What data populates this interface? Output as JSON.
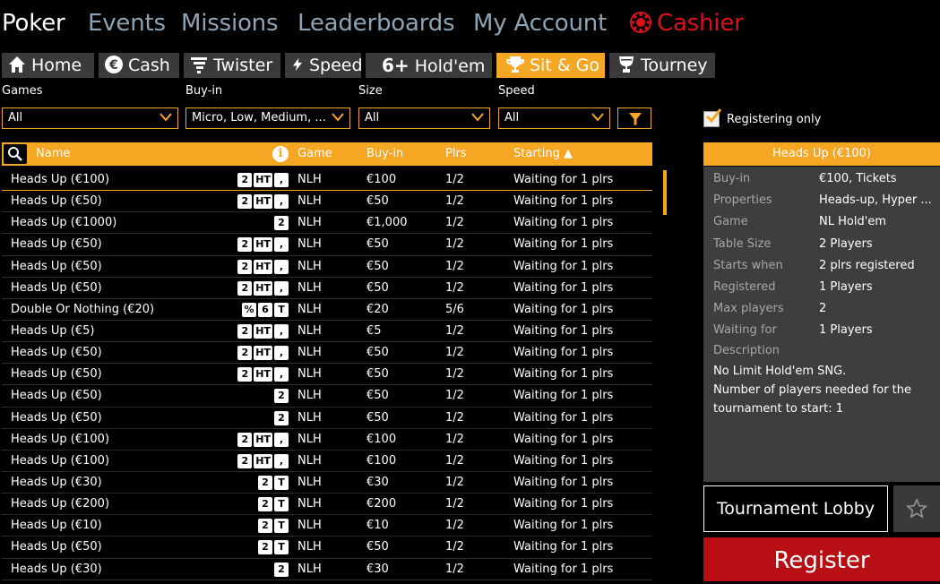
{
  "nav": {
    "items": [
      {
        "label": "Poker",
        "active": true
      },
      {
        "label": "Events"
      },
      {
        "label": "Missions"
      },
      {
        "label": "Leaderboards"
      },
      {
        "label": "My Account"
      },
      {
        "label": "Cashier",
        "icon": "cashier-chip-icon"
      }
    ]
  },
  "tabs": [
    {
      "label": "Home",
      "icon": "home-icon"
    },
    {
      "label": "Cash",
      "icon": "euro-coin-icon"
    },
    {
      "label": "Twister",
      "icon": "twister-icon"
    },
    {
      "label": "Speed",
      "icon": "lightning-icon"
    },
    {
      "label": "Hold'em",
      "icon_text": "6+"
    },
    {
      "label": "Sit & Go",
      "icon": "trophy-icon",
      "active": true
    },
    {
      "label": "Tourney",
      "icon": "trophy-cup-icon"
    }
  ],
  "filters": {
    "games": {
      "label": "Games",
      "value": "All"
    },
    "buyin": {
      "label": "Buy-in",
      "value": "Micro, Low, Medium, ..."
    },
    "size": {
      "label": "Size",
      "value": "All"
    },
    "speed": {
      "label": "Speed",
      "value": "All"
    },
    "registering_only": {
      "label": "Registering only",
      "checked": true
    }
  },
  "table": {
    "columns": {
      "name": "Name",
      "game": "Game",
      "buyin": "Buy-in",
      "plrs": "Plrs",
      "starting": "Starting ▲"
    },
    "rows": [
      {
        "name": "Heads Up (€100)",
        "badges": [
          "2",
          "HT",
          ","
        ],
        "game": "NLH",
        "buyin": "€100",
        "plrs": "1/2",
        "starting": "Waiting for 1 plrs"
      },
      {
        "name": "Heads Up (€50)",
        "badges": [
          "2",
          "HT",
          ","
        ],
        "game": "NLH",
        "buyin": "€50",
        "plrs": "1/2",
        "starting": "Waiting for 1 plrs"
      },
      {
        "name": "Heads Up (€1000)",
        "badges": [
          "2"
        ],
        "game": "NLH",
        "buyin": "€1,000",
        "plrs": "1/2",
        "starting": "Waiting for 1 plrs"
      },
      {
        "name": "Heads Up (€50)",
        "badges": [
          "2",
          "HT",
          ","
        ],
        "game": "NLH",
        "buyin": "€50",
        "plrs": "1/2",
        "starting": "Waiting for 1 plrs"
      },
      {
        "name": "Heads Up (€50)",
        "badges": [
          "2",
          "HT",
          ","
        ],
        "game": "NLH",
        "buyin": "€50",
        "plrs": "1/2",
        "starting": "Waiting for 1 plrs"
      },
      {
        "name": "Heads Up (€50)",
        "badges": [
          "2",
          "HT",
          ","
        ],
        "game": "NLH",
        "buyin": "€50",
        "plrs": "1/2",
        "starting": "Waiting for 1 plrs"
      },
      {
        "name": "Double Or Nothing (€20)",
        "badges": [
          "%",
          "6",
          "T"
        ],
        "game": "NLH",
        "buyin": "€20",
        "plrs": "5/6",
        "starting": "Waiting for 1 plrs"
      },
      {
        "name": "Heads Up (€5)",
        "badges": [
          "2",
          "HT",
          ","
        ],
        "game": "NLH",
        "buyin": "€5",
        "plrs": "1/2",
        "starting": "Waiting for 1 plrs"
      },
      {
        "name": "Heads Up (€50)",
        "badges": [
          "2",
          "HT",
          ","
        ],
        "game": "NLH",
        "buyin": "€50",
        "plrs": "1/2",
        "starting": "Waiting for 1 plrs"
      },
      {
        "name": "Heads Up (€50)",
        "badges": [
          "2",
          "HT",
          ","
        ],
        "game": "NLH",
        "buyin": "€50",
        "plrs": "1/2",
        "starting": "Waiting for 1 plrs"
      },
      {
        "name": "Heads Up (€50)",
        "badges": [
          "2"
        ],
        "game": "NLH",
        "buyin": "€50",
        "plrs": "1/2",
        "starting": "Waiting for 1 plrs"
      },
      {
        "name": "Heads Up (€50)",
        "badges": [
          "2"
        ],
        "game": "NLH",
        "buyin": "€50",
        "plrs": "1/2",
        "starting": "Waiting for 1 plrs"
      },
      {
        "name": "Heads Up (€100)",
        "badges": [
          "2",
          "HT",
          ","
        ],
        "game": "NLH",
        "buyin": "€100",
        "plrs": "1/2",
        "starting": "Waiting for 1 plrs"
      },
      {
        "name": "Heads Up (€100)",
        "badges": [
          "2",
          "HT",
          ","
        ],
        "game": "NLH",
        "buyin": "€100",
        "plrs": "1/2",
        "starting": "Waiting for 1 plrs"
      },
      {
        "name": "Heads Up (€30)",
        "badges": [
          "2",
          "T"
        ],
        "game": "NLH",
        "buyin": "€30",
        "plrs": "1/2",
        "starting": "Waiting for 1 plrs"
      },
      {
        "name": "Heads Up (€200)",
        "badges": [
          "2",
          "T"
        ],
        "game": "NLH",
        "buyin": "€200",
        "plrs": "1/2",
        "starting": "Waiting for 1 plrs"
      },
      {
        "name": "Heads Up (€10)",
        "badges": [
          "2",
          "T"
        ],
        "game": "NLH",
        "buyin": "€10",
        "plrs": "1/2",
        "starting": "Waiting for 1 plrs"
      },
      {
        "name": "Heads Up (€50)",
        "badges": [
          "2",
          "T"
        ],
        "game": "NLH",
        "buyin": "€50",
        "plrs": "1/2",
        "starting": "Waiting for 1 plrs"
      },
      {
        "name": "Heads Up (€30)",
        "badges": [
          "2"
        ],
        "game": "NLH",
        "buyin": "€30",
        "plrs": "1/2",
        "starting": "Waiting for 1 plrs"
      }
    ]
  },
  "details": {
    "title": "Heads Up (€100)",
    "fields": [
      {
        "key": "Buy-in",
        "value": "€100, Tickets"
      },
      {
        "key": "Properties",
        "value": "Heads-up, Hyper ..."
      },
      {
        "key": "Game",
        "value": "NL Hold'em"
      },
      {
        "key": "Table Size",
        "value": "2 Players"
      },
      {
        "key": "Starts when",
        "value": "2 plrs registered"
      },
      {
        "key": "Registered",
        "value": "1 Players"
      },
      {
        "key": "Max players",
        "value": "2"
      },
      {
        "key": "Waiting for",
        "value": "1 Players"
      }
    ],
    "description_label": "Description",
    "description": "No Limit Hold'em SNG.\nNumber of players needed for the tournament to start: 1",
    "lobby_label": "Tournament Lobby",
    "register_label": "Register"
  },
  "colors": {
    "accent": "#f5a623",
    "cashier": "#d9121b",
    "register": "#b80f14",
    "nav_inactive": "#8ea3b4"
  }
}
